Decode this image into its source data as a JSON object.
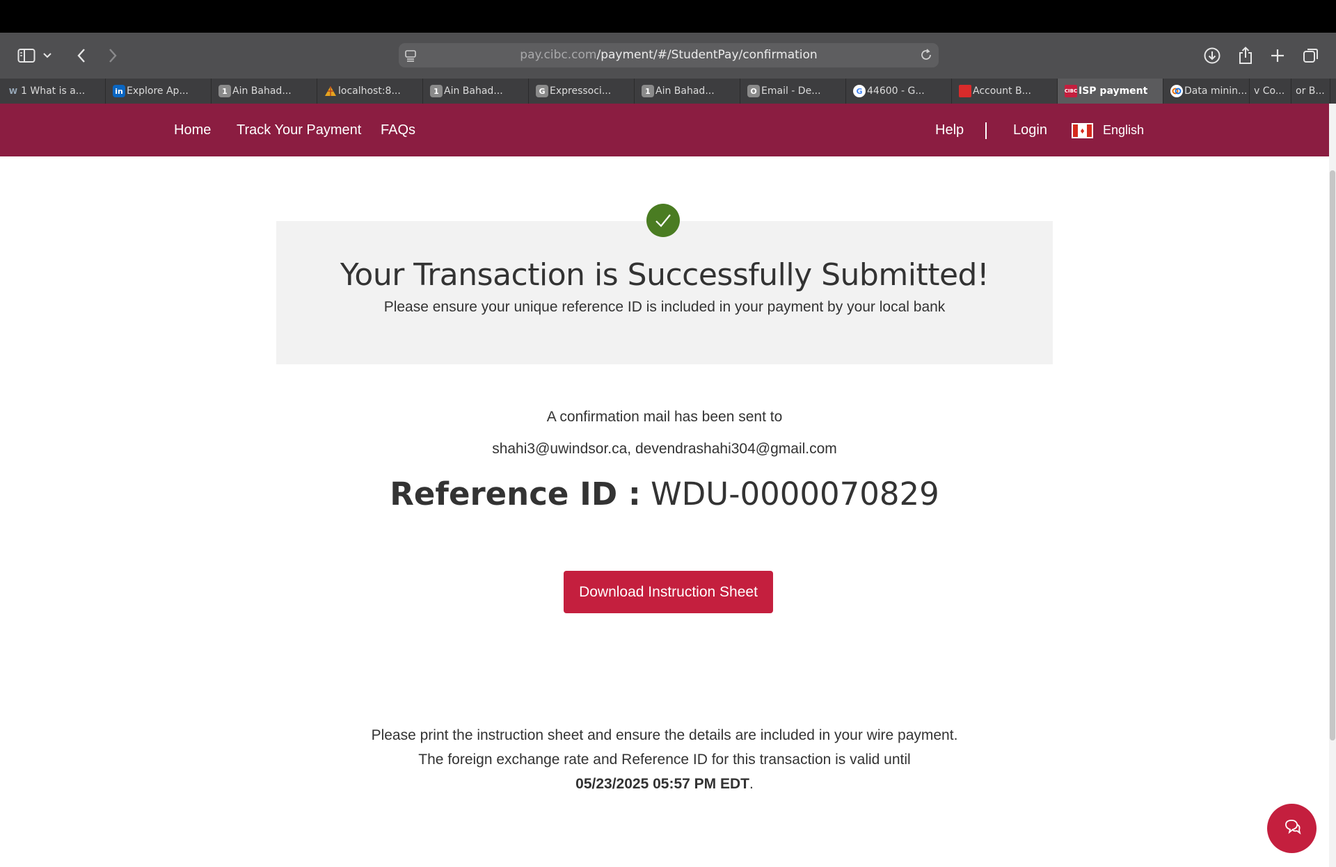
{
  "browser": {
    "url_host": "pay.cibc.com",
    "url_path": "/payment/#/StudentPay/confirmation"
  },
  "tabs": [
    {
      "label": "1 What is a...",
      "favicon": "W",
      "color": "#3d3d3f"
    },
    {
      "label": "Explore Ap...",
      "favicon": "in",
      "color": "#0a66c2"
    },
    {
      "label": "Ain Bahad...",
      "favicon": "1",
      "color": "#8a8a8a"
    },
    {
      "label": "localhost:8...",
      "favicon": "pyramid-icon",
      "color": "#e5a320"
    },
    {
      "label": "Ain Bahad...",
      "favicon": "1",
      "color": "#8a8a8a"
    },
    {
      "label": "Expressoci...",
      "favicon": "G",
      "color": "#8a8a8a"
    },
    {
      "label": "Ain Bahad...",
      "favicon": "1",
      "color": "#8a8a8a"
    },
    {
      "label": "Email - De...",
      "favicon": "O",
      "color": "#8a8a8a"
    },
    {
      "label": "44600 - G...",
      "favicon": "G",
      "color": "#ffffff"
    },
    {
      "label": "Account B...",
      "favicon": "bank-icon",
      "color": "#d92b2b"
    },
    {
      "label": "ISP payment",
      "favicon": "CIBC",
      "color": "#c41f3e",
      "active": true
    },
    {
      "label": "Data minin...",
      "favicon": "colab-icon",
      "color": "#ffffff"
    },
    {
      "label": "v Co...",
      "favicon": "",
      "color": "#3d3d3f"
    },
    {
      "label": "or B...",
      "favicon": "",
      "color": "#3d3d3f"
    }
  ],
  "nav": {
    "home": "Home",
    "track": "Track Your Payment",
    "faqs": "FAQs",
    "help": "Help",
    "login": "Login",
    "language": "English"
  },
  "confirmation": {
    "title": "Your Transaction is Successfully Submitted!",
    "subtitle": "Please ensure your unique reference ID is included in your payment by your local bank",
    "mail_label": "A confirmation mail has been sent to",
    "emails": "shahi3@uwindsor.ca, devendrashahi304@gmail.com",
    "reference_label": "Reference ID :",
    "reference_id": "WDU-0000070829",
    "download_button": "Download Instruction Sheet",
    "note_line1": "Please print the instruction sheet and ensure the details are included in your wire payment.",
    "note_line2": "The foreign exchange rate and Reference ID for this transaction is valid until",
    "valid_until": "05/23/2025 05:57 PM EDT",
    "valid_suffix": "."
  },
  "colors": {
    "brand_nav": "#8b1d41",
    "brand_button": "#c41f3e",
    "success_check": "#4a7c22"
  }
}
